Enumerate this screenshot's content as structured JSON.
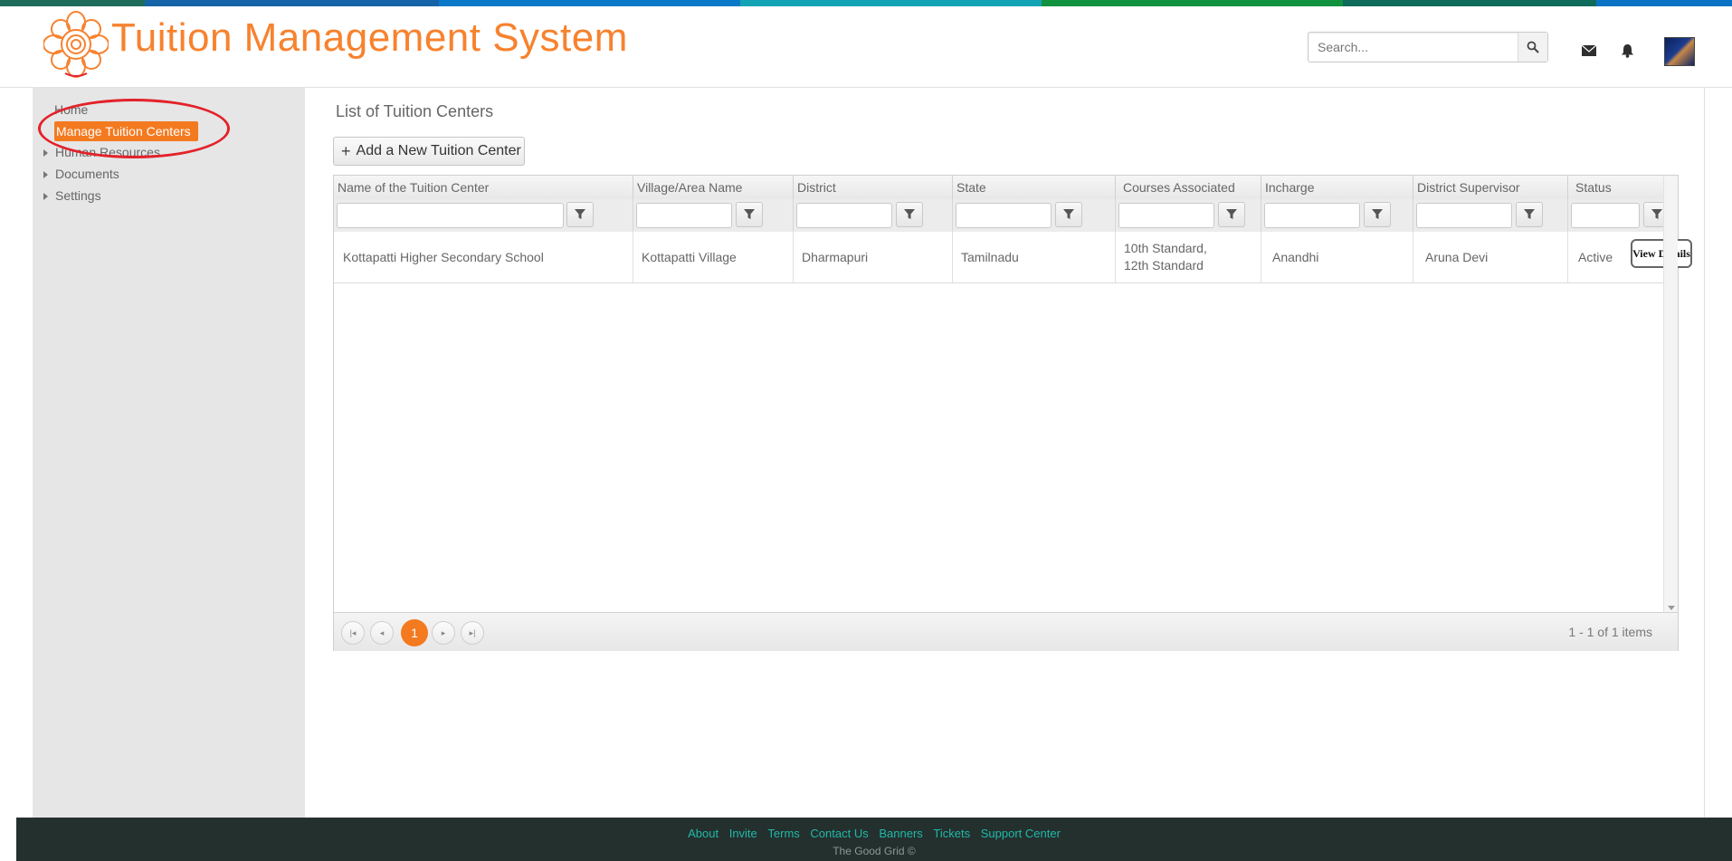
{
  "colors": {
    "brand_orange": "#f47a20",
    "title_orange": "#f7822e",
    "highlight_red": "#e3222a",
    "footer_bg": "#24302e",
    "footer_link": "#20b8a7"
  },
  "header": {
    "title": "Tuition Management System",
    "search_placeholder": "Search...",
    "icons": [
      "flower-logo",
      "search-icon",
      "mail-icon",
      "bell-icon",
      "avatar"
    ]
  },
  "sidebar": {
    "home": "Home",
    "active": "Manage Tuition  Centers",
    "human_resources": "Human Resources",
    "documents": "Documents",
    "settings": "Settings"
  },
  "main": {
    "page_title": "List of Tuition Centers",
    "add_button": "Add a New Tuition Center"
  },
  "grid": {
    "columns": [
      "Name of the Tuition Center",
      "Village/Area Name",
      "District",
      "State",
      "Courses Associated",
      "Incharge",
      "District Supervisor",
      "Status"
    ],
    "rows": [
      {
        "name": "Kottapatti Higher Secondary School",
        "village": "Kottapatti Village",
        "district": "Dharmapuri",
        "state": "Tamilnadu",
        "courses_line1": "10th Standard,",
        "courses_line2": "12th Standard",
        "incharge": "Anandhi",
        "supervisor": "Aruna Devi",
        "status": "Active",
        "action": "View Details"
      }
    ],
    "pager": {
      "current_page": "1",
      "info": "1 - 1 of 1 items"
    }
  },
  "footer": {
    "links": [
      "About",
      "Invite",
      "Terms",
      "Contact Us",
      "Banners",
      "Tickets",
      "Support Center"
    ],
    "copyright": "The Good Grid ©"
  }
}
